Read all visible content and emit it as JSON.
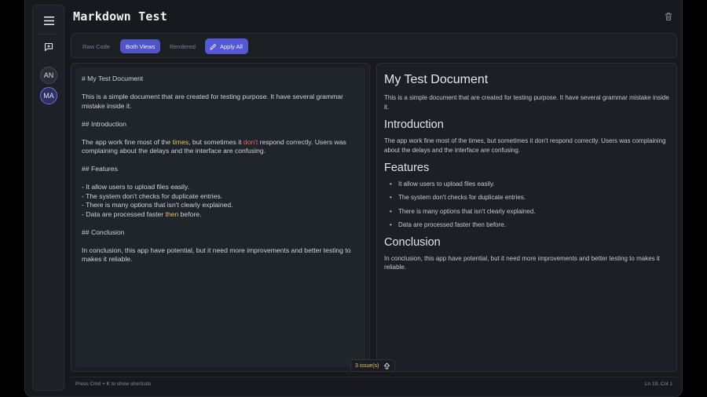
{
  "app": {
    "title": "Markdown Test"
  },
  "sidebar": {
    "avatars": [
      {
        "initials": "AN"
      },
      {
        "initials": "MA"
      }
    ]
  },
  "toolbar": {
    "raw_label": "Raw Code",
    "both_label": "Both Views",
    "rendered_label": "Rendered",
    "apply_label": "Apply All"
  },
  "editor": {
    "l1": "# My Test Document",
    "l2": "This is a simple document that are created for testing purpose. It have several grammar mistake inside it.",
    "l3": "## Introduction",
    "l4a": "The app work fine most of the ",
    "l4b": "times",
    "l4c": ", but sometimes it ",
    "l4d": "don't",
    "l4e": " respond correctly. Users was complaining about the delays and the interface are confusing.",
    "l5": "## Features",
    "l6": "- It allow users to upload files easily.",
    "l7": "- The system don't checks for duplicate entries.",
    "l8": "- There is many options that isn't clearly explained.",
    "l9a": "- Data are processed faster ",
    "l9b": "then",
    "l9c": " before.",
    "l10": "## Conclusion",
    "l11": "In conclusion, this app have potential, but it need more improvements and better testing to makes it reliable."
  },
  "preview": {
    "h1": "My Test Document",
    "p1": "This is a simple document that are created for testing purpose. It have several grammar mistake inside it.",
    "h2_intro": "Introduction",
    "p2": "The app work fine most of the times, but sometimes it don't respond correctly. Users was complaining about the delays and the interface are confusing.",
    "h2_features": "Features",
    "features": [
      "It allow users to upload files easily.",
      "The system don't checks for duplicate entries.",
      "There is many options that isn't clearly explained.",
      "Data are processed faster then before."
    ],
    "h2_conclusion": "Conclusion",
    "p3": "In conclusion, this app have potential, but it need more improvements and better testing to makes it reliable."
  },
  "issues": {
    "label": "3 issue(s)"
  },
  "status": {
    "hint": "Press Cmd + K to show shortcuts",
    "cursor": "Ln 19, Col 1"
  },
  "colors": {
    "accent": "#5558d6",
    "highlight_warning": "#e9c463",
    "highlight_error": "#e26a5e"
  }
}
